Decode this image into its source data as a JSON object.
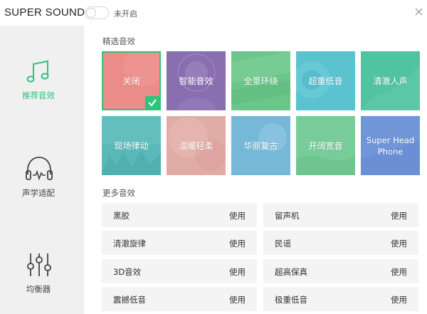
{
  "titlebar": {
    "app_title": "SUPER SOUND",
    "toggle_state": "off",
    "toggle_label": "未开启"
  },
  "sidebar": {
    "items": [
      {
        "label": "推荐音效",
        "icon": "music-note-icon",
        "active": true
      },
      {
        "label": "声学适配",
        "icon": "headphones-icon",
        "active": false
      },
      {
        "label": "均衡器",
        "icon": "equalizer-icon",
        "active": false
      }
    ]
  },
  "featured": {
    "title": "精选音效",
    "tiles": [
      {
        "label": "关闭",
        "color": "#e8837f",
        "selected": true
      },
      {
        "label": "智能音效",
        "color": "#8a6fb0",
        "selected": false
      },
      {
        "label": "全景环绕",
        "color": "#6cc58a",
        "selected": false
      },
      {
        "label": "超重低音",
        "color": "#5bc2cf",
        "selected": false
      },
      {
        "label": "清澈人声",
        "color": "#52c3a0",
        "selected": false
      },
      {
        "label": "现场律动",
        "color": "#5ab9b8",
        "selected": false
      },
      {
        "label": "温暖轻柔",
        "color": "#e1aba6",
        "selected": false
      },
      {
        "label": "华丽复古",
        "color": "#6fb3d5",
        "selected": false
      },
      {
        "label": "开阔宽音",
        "color": "#78cc99",
        "selected": false
      },
      {
        "label": "Super Head Phone",
        "color": "#6a8fd4",
        "selected": false
      }
    ]
  },
  "more": {
    "title": "更多音效",
    "use_label": "使用",
    "effects": [
      "黑胶",
      "留声机",
      "清澈旋律",
      "民谣",
      "3D音效",
      "超高保真",
      "震撼低音",
      "极重低音"
    ]
  },
  "colors": {
    "accent": "#31c27c",
    "sidebar_bg": "#f0f0f0",
    "row_bg": "#f4f4f4"
  }
}
